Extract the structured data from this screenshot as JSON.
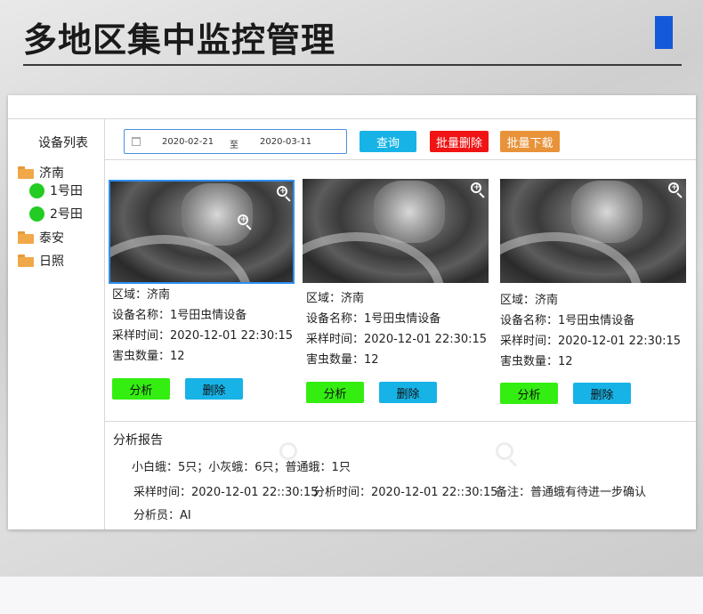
{
  "header": {
    "title": "多地区集中监控管理"
  },
  "sidebar": {
    "title": "设备列表",
    "tree": [
      {
        "label": "济南",
        "icon": "folder-open-icon",
        "children": [
          {
            "label": "1号田",
            "icon": "status-dot-icon",
            "status_color": "#22cc22"
          },
          {
            "label": "2号田",
            "icon": "status-dot-icon",
            "status_color": "#22cc22"
          }
        ]
      },
      {
        "label": "泰安",
        "icon": "folder-icon"
      },
      {
        "label": "日照",
        "icon": "folder-icon"
      }
    ]
  },
  "toolbar": {
    "date_start": "2020-02-21",
    "date_separator": "至",
    "date_end": "2020-03-11",
    "query_label": "查询",
    "batch_delete_label": "批量删除",
    "batch_download_label": "批量下载"
  },
  "cards": [
    {
      "selected": true,
      "region": "区域：济南",
      "device": "设备名称：1号田虫情设备",
      "time": "采样时间：2020-12-01 22:30:15",
      "count": "害虫数量：12",
      "analyze_label": "分析",
      "delete_label": "删除"
    },
    {
      "selected": false,
      "region": "区域：济南",
      "device": "设备名称：1号田虫情设备",
      "time": "采样时间：2020-12-01 22:30:15",
      "count": "害虫数量：12",
      "analyze_label": "分析",
      "delete_label": "删除"
    },
    {
      "selected": false,
      "region": "区域：济南",
      "device": "设备名称：1号田虫情设备",
      "time": "采样时间：2020-12-01 22:30:15",
      "count": "害虫数量：12",
      "analyze_label": "分析",
      "delete_label": "删除"
    }
  ],
  "report": {
    "title": "分析报告",
    "line1": "小白蛾：5只；小灰蛾：6只；普通蛾：1只",
    "sample_time": "采样时间：2020-12-01  22::30:15",
    "analysis_time": "分析时间：2020-12-01  22::30:15",
    "note": "备注：普通蛾有待进一步确认",
    "analyst": "分析员：AI"
  },
  "colors": {
    "accent_blue": "#1459d9",
    "query": "#17b3e6",
    "batch_delete": "#f01414",
    "batch_download": "#e8933a",
    "analyze": "#33ee10",
    "folder": "#f0a848",
    "status_online": "#22cc22"
  }
}
